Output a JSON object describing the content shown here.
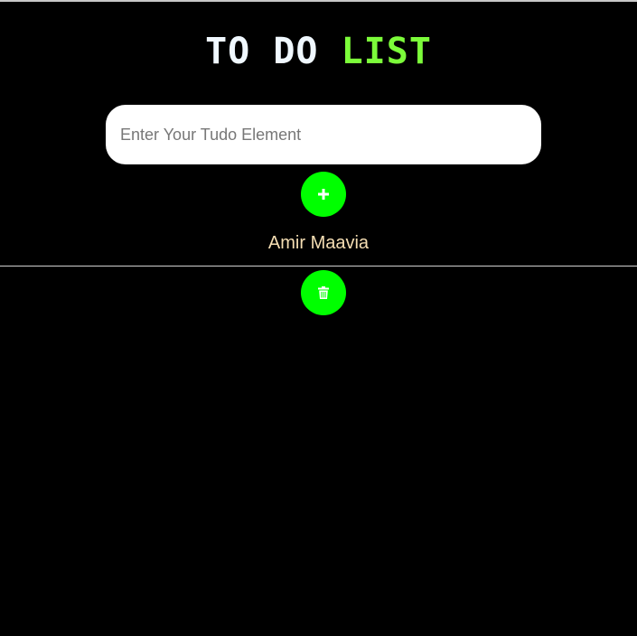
{
  "app": {
    "title_part1": "TO DO",
    "title_part2": "LIST"
  },
  "input": {
    "placeholder": "Enter Your Tudo Element",
    "value": ""
  },
  "buttons": {
    "add_icon": "plus-icon",
    "delete_icon": "trash-icon"
  },
  "items": [
    {
      "text": "Amir Maavia"
    }
  ],
  "colors": {
    "background": "#000000",
    "title_primary": "#f0f8ff",
    "title_accent": "#7cfc3a",
    "button": "#00ff00",
    "item_text": "#f5deb3"
  }
}
